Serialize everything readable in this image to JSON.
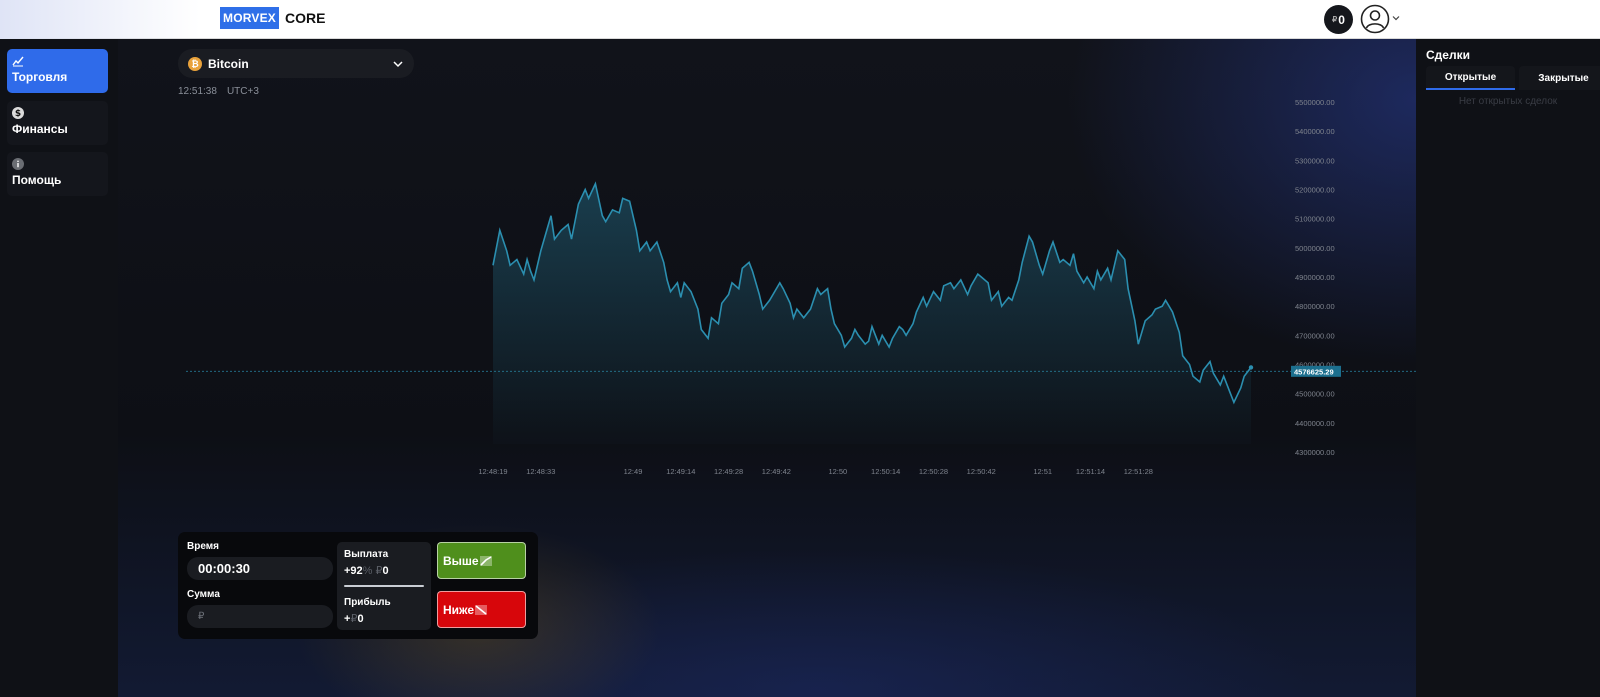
{
  "header": {
    "logo_box": "MORVEX",
    "logo_text": "CORE",
    "balance_currency": "₽",
    "balance_value": "0"
  },
  "sidebar": {
    "items": [
      {
        "label": "Торговля",
        "icon": "chart-line-icon",
        "active": true
      },
      {
        "label": "Финансы",
        "icon": "dollar-icon",
        "active": false
      },
      {
        "label": "Помощь",
        "icon": "info-icon",
        "active": false
      }
    ]
  },
  "asset": {
    "name": "Bitcoin",
    "icon_glyph": "₿",
    "time": "12:51:38",
    "timezone": "UTC+3"
  },
  "chart_data": {
    "type": "area",
    "title": "",
    "xlabel": "",
    "ylabel": "",
    "y_ticks": [
      "5500000.00",
      "5400000.00",
      "5300000.00",
      "5200000.00",
      "5100000.00",
      "5000000.00",
      "4900000.00",
      "4800000.00",
      "4700000.00",
      "4600000.00",
      "4500000.00",
      "4400000.00",
      "4300000.00"
    ],
    "ylim": [
      4300000,
      5500000
    ],
    "x_ticks": [
      {
        "label": "12:48:19",
        "t": 0
      },
      {
        "label": "12:48:33",
        "t": 14
      },
      {
        "label": "12:49",
        "t": 41
      },
      {
        "label": "12:49:14",
        "t": 55
      },
      {
        "label": "12:49:28",
        "t": 69
      },
      {
        "label": "12:49:42",
        "t": 83
      },
      {
        "label": "12:50",
        "t": 101
      },
      {
        "label": "12:50:14",
        "t": 115
      },
      {
        "label": "12:50:28",
        "t": 129
      },
      {
        "label": "12:50:42",
        "t": 143
      },
      {
        "label": "12:51",
        "t": 161
      },
      {
        "label": "12:51:14",
        "t": 175
      },
      {
        "label": "12:51:28",
        "t": 189
      }
    ],
    "x_range": [
      0,
      199
    ],
    "series": [
      {
        "points": [
          [
            0,
            4940000
          ],
          [
            2,
            5060000
          ],
          [
            4,
            4990000
          ],
          [
            5,
            4940000
          ],
          [
            7,
            4960000
          ],
          [
            9,
            4910000
          ],
          [
            10,
            4960000
          ],
          [
            11,
            4920000
          ],
          [
            12,
            4890000
          ],
          [
            14,
            4990000
          ],
          [
            16,
            5070000
          ],
          [
            17,
            5110000
          ],
          [
            18,
            5030000
          ],
          [
            20,
            5060000
          ],
          [
            22,
            5080000
          ],
          [
            23,
            5030000
          ],
          [
            25,
            5150000
          ],
          [
            27,
            5200000
          ],
          [
            28,
            5170000
          ],
          [
            30,
            5220000
          ],
          [
            32,
            5110000
          ],
          [
            33,
            5090000
          ],
          [
            35,
            5130000
          ],
          [
            37,
            5120000
          ],
          [
            38,
            5170000
          ],
          [
            40,
            5160000
          ],
          [
            42,
            5060000
          ],
          [
            43,
            4990000
          ],
          [
            45,
            5020000
          ],
          [
            46,
            4990000
          ],
          [
            48,
            5020000
          ],
          [
            50,
            4950000
          ],
          [
            51,
            4890000
          ],
          [
            52,
            4850000
          ],
          [
            54,
            4880000
          ],
          [
            55,
            4830000
          ],
          [
            56,
            4880000
          ],
          [
            58,
            4850000
          ],
          [
            60,
            4790000
          ],
          [
            61,
            4720000
          ],
          [
            63,
            4690000
          ],
          [
            64,
            4760000
          ],
          [
            66,
            4740000
          ],
          [
            67,
            4810000
          ],
          [
            69,
            4840000
          ],
          [
            70,
            4880000
          ],
          [
            72,
            4860000
          ],
          [
            73,
            4930000
          ],
          [
            75,
            4950000
          ],
          [
            76,
            4920000
          ],
          [
            78,
            4840000
          ],
          [
            79,
            4790000
          ],
          [
            81,
            4820000
          ],
          [
            82,
            4840000
          ],
          [
            84,
            4880000
          ],
          [
            85,
            4860000
          ],
          [
            87,
            4810000
          ],
          [
            88,
            4760000
          ],
          [
            89,
            4790000
          ],
          [
            91,
            4760000
          ],
          [
            93,
            4790000
          ],
          [
            95,
            4860000
          ],
          [
            96,
            4840000
          ],
          [
            98,
            4860000
          ],
          [
            99,
            4790000
          ],
          [
            100,
            4740000
          ],
          [
            102,
            4700000
          ],
          [
            103,
            4660000
          ],
          [
            105,
            4690000
          ],
          [
            106,
            4720000
          ],
          [
            107,
            4700000
          ],
          [
            109,
            4670000
          ],
          [
            110,
            4680000
          ],
          [
            111,
            4730000
          ],
          [
            113,
            4670000
          ],
          [
            114,
            4700000
          ],
          [
            116,
            4660000
          ],
          [
            117,
            4690000
          ],
          [
            119,
            4730000
          ],
          [
            120,
            4720000
          ],
          [
            121,
            4700000
          ],
          [
            123,
            4740000
          ],
          [
            124,
            4780000
          ],
          [
            126,
            4830000
          ],
          [
            127,
            4800000
          ],
          [
            129,
            4850000
          ],
          [
            131,
            4820000
          ],
          [
            132,
            4870000
          ],
          [
            134,
            4880000
          ],
          [
            135,
            4860000
          ],
          [
            137,
            4890000
          ],
          [
            139,
            4840000
          ],
          [
            140,
            4870000
          ],
          [
            142,
            4910000
          ],
          [
            143,
            4900000
          ],
          [
            145,
            4880000
          ],
          [
            146,
            4820000
          ],
          [
            148,
            4850000
          ],
          [
            149,
            4800000
          ],
          [
            151,
            4830000
          ],
          [
            152,
            4820000
          ],
          [
            154,
            4890000
          ],
          [
            155,
            4950000
          ],
          [
            157,
            5040000
          ],
          [
            158,
            5020000
          ],
          [
            160,
            4940000
          ],
          [
            161,
            4910000
          ],
          [
            163,
            4990000
          ],
          [
            164,
            5020000
          ],
          [
            166,
            4950000
          ],
          [
            167,
            4960000
          ],
          [
            169,
            4940000
          ],
          [
            170,
            4980000
          ],
          [
            171,
            4920000
          ],
          [
            173,
            4880000
          ],
          [
            174,
            4900000
          ],
          [
            176,
            4860000
          ],
          [
            177,
            4920000
          ],
          [
            178,
            4890000
          ],
          [
            180,
            4930000
          ],
          [
            181,
            4890000
          ],
          [
            183,
            4990000
          ],
          [
            185,
            4960000
          ],
          [
            186,
            4860000
          ],
          [
            188,
            4750000
          ],
          [
            189,
            4670000
          ],
          [
            191,
            4750000
          ],
          [
            193,
            4770000
          ],
          [
            194,
            4790000
          ],
          [
            196,
            4800000
          ],
          [
            197,
            4820000
          ],
          [
            199,
            4780000
          ],
          [
            201,
            4710000
          ],
          [
            202,
            4630000
          ],
          [
            204,
            4600000
          ],
          [
            205,
            4560000
          ],
          [
            207,
            4540000
          ],
          [
            208,
            4580000
          ],
          [
            210,
            4610000
          ],
          [
            211,
            4570000
          ],
          [
            213,
            4530000
          ],
          [
            214,
            4560000
          ],
          [
            216,
            4500000
          ],
          [
            217,
            4470000
          ],
          [
            219,
            4520000
          ],
          [
            220,
            4560000
          ],
          [
            222,
            4590000
          ]
        ]
      }
    ],
    "current_value": "4576625.29",
    "current_level": 4576625.29,
    "grid": false,
    "legend": "none"
  },
  "trade": {
    "time_label": "Время",
    "time_value": "00:00:30",
    "amount_label": "Сумма",
    "amount_placeholder": "₽",
    "payout_label": "Выплата",
    "payout_value": "+92",
    "payout_pct": "%",
    "payout_cur": "₽",
    "payout_amount": "0",
    "profit_label": "Прибыль",
    "profit_value": "+",
    "profit_cur": "₽",
    "profit_amount": "0",
    "up_label": "Выше",
    "down_label": "Ниже"
  },
  "deals": {
    "title": "Сделки",
    "tab_open": "Открытые",
    "tab_closed": "Закрытые",
    "empty_text": "Нет открытых сделок"
  },
  "colors": {
    "accent": "#2f6bea",
    "line": "#2b8fb0",
    "up": "#4f8f1c",
    "down": "#d7060b"
  }
}
